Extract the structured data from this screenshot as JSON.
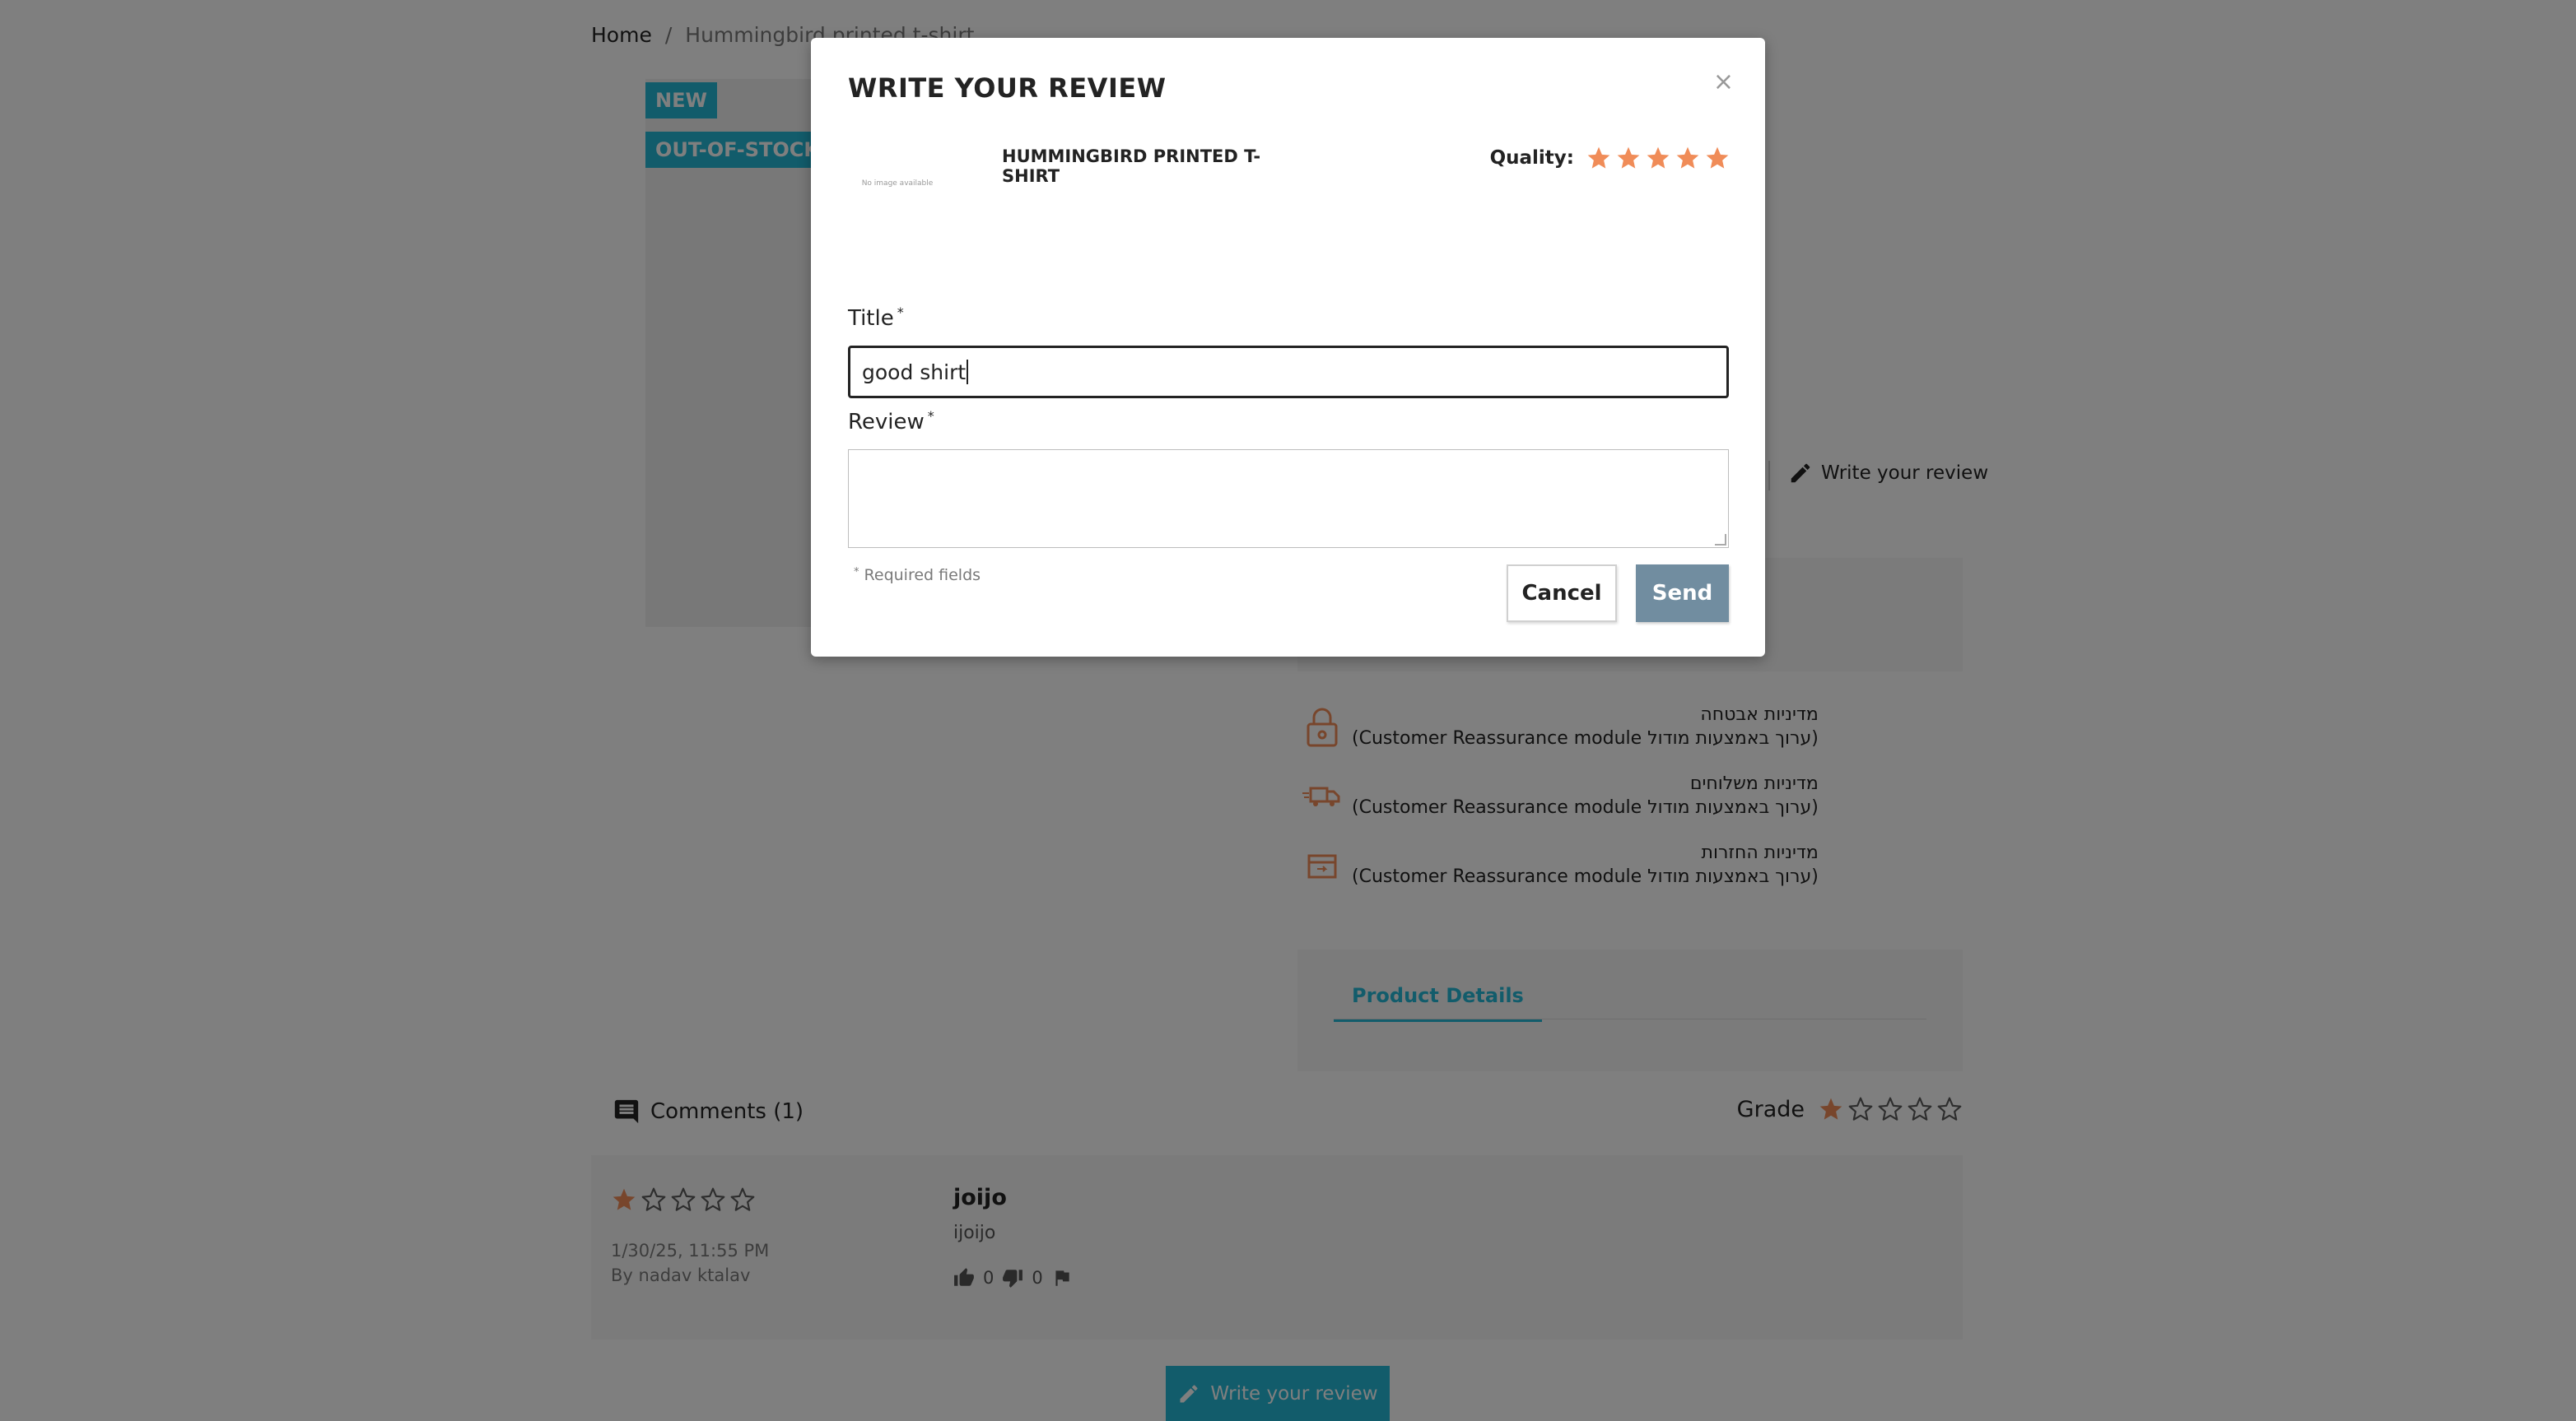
{
  "breadcrumb": {
    "home": "Home",
    "separator": "/",
    "current": "Hummingbird printed t-shirt"
  },
  "product": {
    "flags": {
      "new": "NEW",
      "out_of_stock": "OUT-OF-STOCK"
    },
    "write_review_link": "Write your review"
  },
  "reassurance": [
    {
      "icon": "lock-icon",
      "title": "מדיניות אבטחה",
      "desc": "(ערוך באמצעות מודול Customer Reassurance module)"
    },
    {
      "icon": "truck-icon",
      "title": "מדיניות משלוחים",
      "desc": "(ערוך באמצעות מודול Customer Reassurance module)"
    },
    {
      "icon": "return-box-icon",
      "title": "מדיניות החזרות",
      "desc": "(ערוך באמצעות מודול Customer Reassurance module)"
    }
  ],
  "tabs": {
    "product_details": "Product Details"
  },
  "comments": {
    "title": "Comments (1)",
    "grade_label": "Grade",
    "grade_value": 1,
    "grade_max": 5,
    "items": [
      {
        "rating": 1,
        "date": "1/30/25, 11:55 PM",
        "by": "By nadav ktalav",
        "author": "joijo",
        "text": "ijoijo",
        "useful": "0",
        "not_useful": "0"
      }
    ],
    "write_button": "Write your review"
  },
  "modal": {
    "title": "WRITE YOUR REVIEW",
    "close": "×",
    "thumb_text": "No image available",
    "product_name": "HUMMINGBIRD PRINTED T-SHIRT",
    "quality_label": "Quality:",
    "quality_rating": 5,
    "title_label": "Title",
    "title_value": "good shirt",
    "review_label": "Review",
    "review_value": "",
    "required_mark": "*",
    "required_note": "Required fields",
    "cancel_label": "Cancel",
    "send_label": "Send"
  },
  "colors": {
    "accent": "#24b9d7",
    "star_filled": "#f08c58",
    "star_empty": "#5a5a5a",
    "send_button": "#718da0",
    "overlay": "rgba(0,0,0,0.5)"
  }
}
